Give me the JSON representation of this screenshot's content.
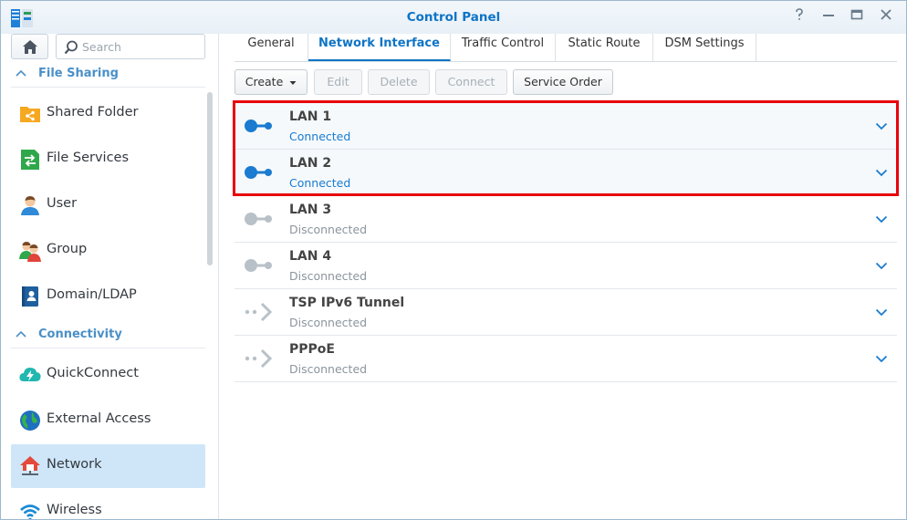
{
  "window": {
    "title": "Control Panel",
    "controls": [
      "help-icon",
      "minimize-icon",
      "maximize-icon",
      "close-icon"
    ]
  },
  "sidebar": {
    "search_placeholder": "Search",
    "sections": [
      {
        "label": "File Sharing"
      },
      {
        "label": "Connectivity"
      }
    ],
    "items": [
      {
        "label": "Shared Folder",
        "icon": "shared-folder-icon"
      },
      {
        "label": "File Services",
        "icon": "file-services-icon"
      },
      {
        "label": "User",
        "icon": "user-icon"
      },
      {
        "label": "Group",
        "icon": "group-icon"
      },
      {
        "label": "Domain/LDAP",
        "icon": "domain-ldap-icon"
      },
      {
        "label": "QuickConnect",
        "icon": "quickconnect-icon"
      },
      {
        "label": "External Access",
        "icon": "external-access-icon"
      },
      {
        "label": "Network",
        "icon": "network-icon",
        "active": true
      },
      {
        "label": "Wireless",
        "icon": "wireless-icon"
      }
    ]
  },
  "tabs": [
    {
      "label": "General"
    },
    {
      "label": "Network Interface",
      "active": true
    },
    {
      "label": "Traffic Control"
    },
    {
      "label": "Static Route"
    },
    {
      "label": "DSM Settings"
    }
  ],
  "toolbar": {
    "create": "Create",
    "edit": "Edit",
    "delete": "Delete",
    "connect": "Connect",
    "service_order": "Service Order"
  },
  "interfaces": [
    {
      "name": "LAN 1",
      "status": "Connected",
      "state": "connected"
    },
    {
      "name": "LAN 2",
      "status": "Connected",
      "state": "connected"
    },
    {
      "name": "LAN 3",
      "status": "Disconnected",
      "state": "disconnected"
    },
    {
      "name": "LAN 4",
      "status": "Disconnected",
      "state": "disconnected"
    },
    {
      "name": "TSP IPv6 Tunnel",
      "status": "Disconnected",
      "state": "disconnected"
    },
    {
      "name": "PPPoE",
      "status": "Disconnected",
      "state": "disconnected"
    }
  ],
  "colors": {
    "accent": "#0d74c6",
    "connected": "#1a7bd0",
    "disconnected": "#8b959d",
    "highlight": "#e8000b",
    "active_nav": "#cfe6f9"
  }
}
